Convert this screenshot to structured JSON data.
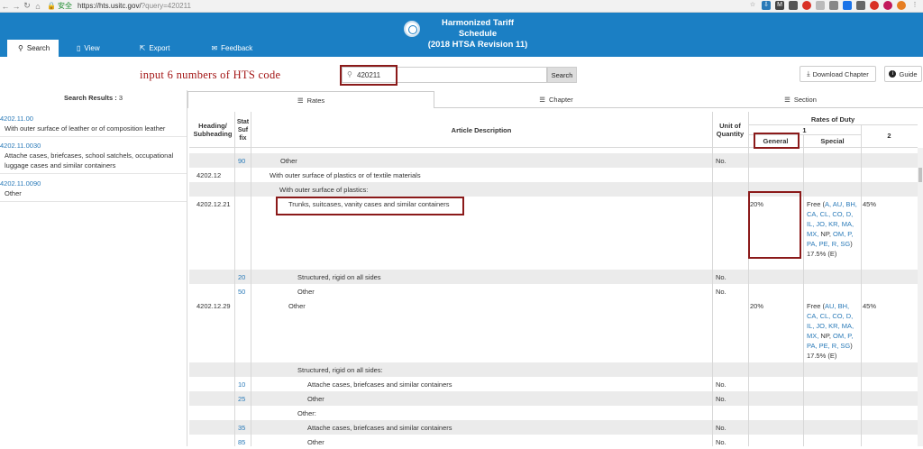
{
  "browser": {
    "secure_label": "安全",
    "url": "https://hts.usitc.gov/",
    "url_query": "?query=420211"
  },
  "header": {
    "title_line1": "Harmonized Tariff Schedule",
    "title_line2": "(2018 HTSA Revision 11)",
    "tabs": [
      {
        "label": "Search",
        "icon": "search-icon"
      },
      {
        "label": "View",
        "icon": "document-icon"
      },
      {
        "label": "Export",
        "icon": "export-icon"
      },
      {
        "label": "Feedback",
        "icon": "feedback-icon"
      }
    ]
  },
  "annotation": "input 6 numbers of HTS code",
  "search": {
    "value": "420211",
    "button": "Search"
  },
  "actions": {
    "download": "Download Chapter",
    "guide": "Guide"
  },
  "results": {
    "heading": "Search Results :",
    "count": "3",
    "items": [
      {
        "code": "4202.11.00",
        "desc": "With outer surface of leather or of composition leather"
      },
      {
        "code": "4202.11.0030",
        "desc": "Attache cases, briefcases, school satchels, occupational luggage cases and similar containers"
      },
      {
        "code": "4202.11.0090",
        "desc": "Other"
      }
    ]
  },
  "subtabs": [
    {
      "label": "Rates",
      "icon": "list-icon"
    },
    {
      "label": "Chapter",
      "icon": "list-icon"
    },
    {
      "label": "Section",
      "icon": "list-icon"
    }
  ],
  "table": {
    "headers": {
      "heading": "Heading/ Subheading",
      "stat": "Stat Suf fix",
      "article": "Article Description",
      "unit": "Unit of Quantity",
      "rates": "Rates of Duty",
      "col1": "1",
      "general": "General",
      "special": "Special",
      "col2": "2"
    },
    "rows": [
      {
        "heading": "",
        "stat": "90",
        "desc": "Other",
        "unit": "No.",
        "general": "",
        "special": "",
        "col2": ""
      },
      {
        "heading": "4202.12",
        "stat": "",
        "desc": "With outer surface of plastics or of textile materials",
        "unit": "",
        "general": "",
        "special": "",
        "col2": ""
      },
      {
        "heading": "",
        "stat": "",
        "desc": "With outer surface of plastics:",
        "unit": "",
        "general": "",
        "special": "",
        "col2": ""
      },
      {
        "heading": "4202.12.21",
        "stat": "",
        "desc": "Trunks, suitcases, vanity cases and similar containers",
        "unit": "",
        "general": "20%",
        "special_prefix": "Free (",
        "special_codes": "A, AU, BH, CA, CL, CO, D, IL, JO, KR, MA, MX,",
        "special_np": " NP, ",
        "special_codes2": "OM, P, PA, PE, R, SG",
        "special_suffix": ")",
        "special_rate": "17.5% (E)",
        "col2": "45%"
      },
      {
        "heading": "",
        "stat": "20",
        "desc": "Structured, rigid on all sides",
        "unit": "No.",
        "general": "",
        "special": "",
        "col2": ""
      },
      {
        "heading": "",
        "stat": "50",
        "desc": "Other",
        "unit": "No.",
        "general": "",
        "special": "",
        "col2": ""
      },
      {
        "heading": "4202.12.29",
        "stat": "",
        "desc": "Other",
        "unit": "",
        "general": "20%",
        "special_prefix": "Free (",
        "special_codes": "AU, BH, CA, CL, CO, D, IL, JO, KR, MA, MX,",
        "special_np": " NP, ",
        "special_codes2": "OM, P, PA, PE, R, SG",
        "special_suffix": ")",
        "special_rate": "17.5% (E)",
        "col2": "45%"
      },
      {
        "heading": "",
        "stat": "",
        "desc": "Structured, rigid on all sides:",
        "unit": "",
        "general": "",
        "special": "",
        "col2": ""
      },
      {
        "heading": "",
        "stat": "10",
        "desc": "Attache cases, briefcases and similar containers",
        "unit": "No.",
        "general": "",
        "special": "",
        "col2": ""
      },
      {
        "heading": "",
        "stat": "25",
        "desc": "Other",
        "unit": "No.",
        "general": "",
        "special": "",
        "col2": ""
      },
      {
        "heading": "",
        "stat": "",
        "desc": "Other:",
        "unit": "",
        "general": "",
        "special": "",
        "col2": ""
      },
      {
        "heading": "",
        "stat": "35",
        "desc": "Attache cases, briefcases and similar containers",
        "unit": "No.",
        "general": "",
        "special": "",
        "col2": ""
      },
      {
        "heading": "",
        "stat": "85",
        "desc": "Other",
        "unit": "No.",
        "general": "",
        "special": "",
        "col2": ""
      }
    ]
  }
}
